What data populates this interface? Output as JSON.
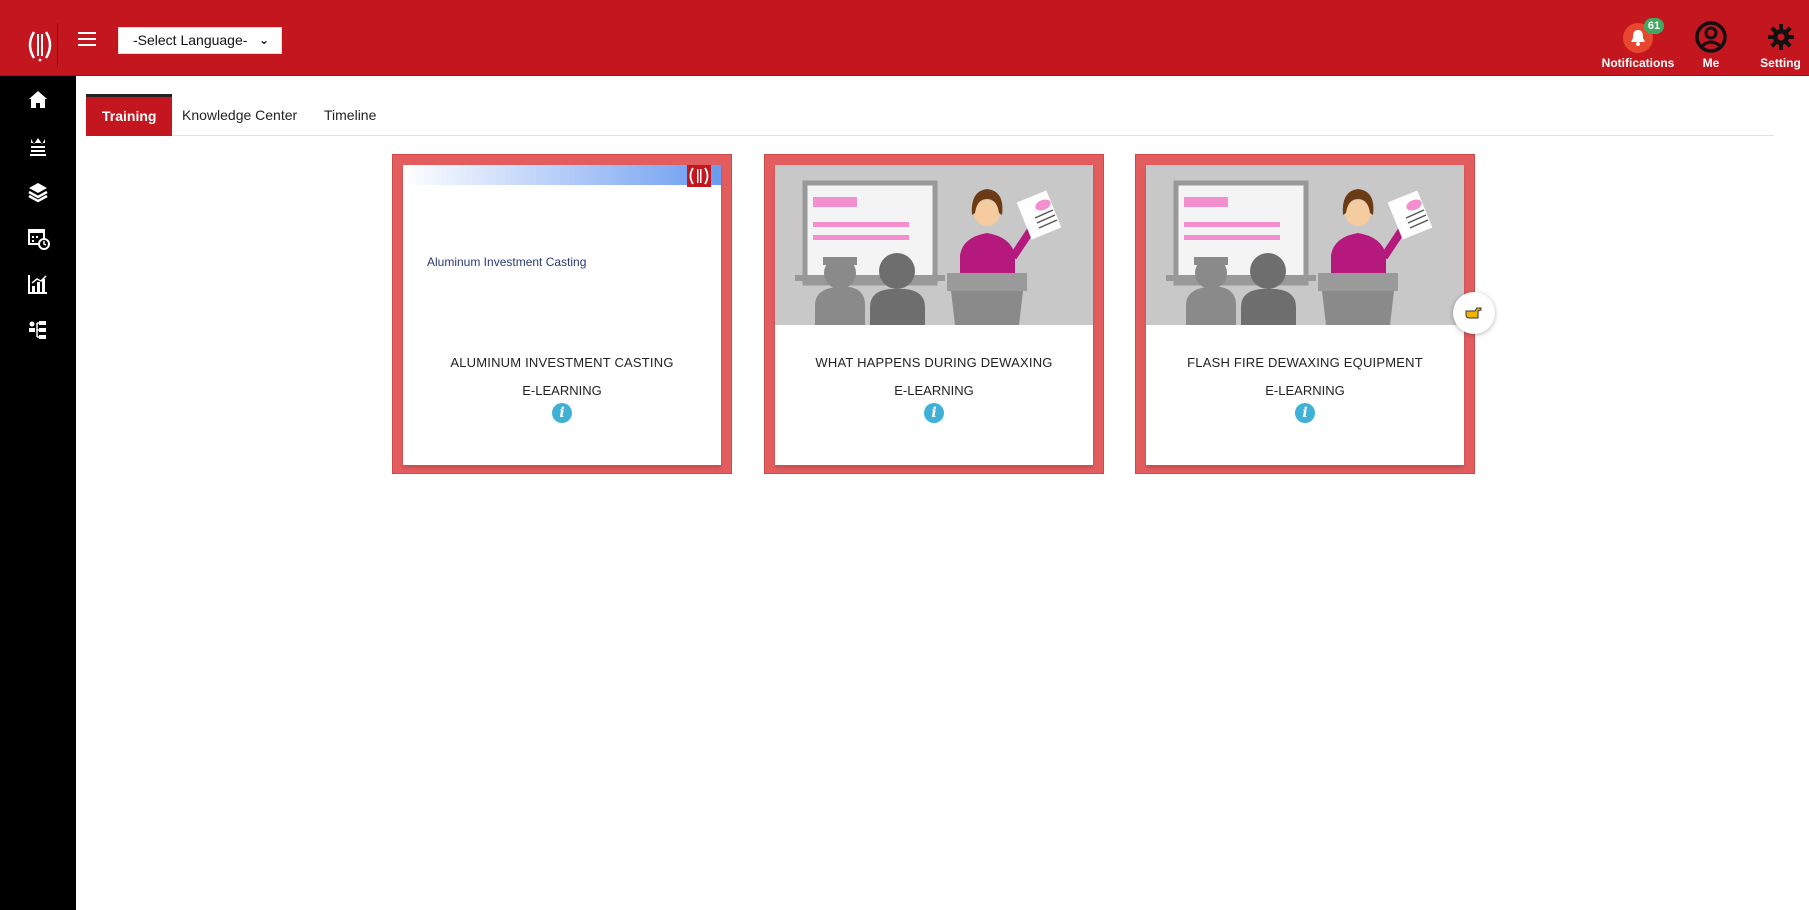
{
  "header": {
    "language_select": "-Select Language-",
    "notifications_label": "Notifications",
    "notifications_count": "61",
    "me_label": "Me",
    "setting_label": "Setting",
    "brand_color": "#c4161e"
  },
  "sidebar": {
    "items": [
      {
        "icon": "home-icon"
      },
      {
        "icon": "trophy-icon"
      },
      {
        "icon": "layers-icon"
      },
      {
        "icon": "calendar-clock-icon"
      },
      {
        "icon": "chart-icon"
      },
      {
        "icon": "org-chart-icon"
      }
    ]
  },
  "tabs": [
    {
      "label": "Training",
      "active": true
    },
    {
      "label": "Knowledge Center",
      "active": false
    },
    {
      "label": "Timeline",
      "active": false
    }
  ],
  "cards": [
    {
      "image_text": "Aluminum Investment Casting",
      "title": "ALUMINUM INVESTMENT CASTING",
      "type": "E-LEARNING",
      "info": "i"
    },
    {
      "title": "WHAT HAPPENS DURING DEWAXING",
      "type": "E-LEARNING",
      "info": "i"
    },
    {
      "title": "FLASH FIRE DEWAXING EQUIPMENT",
      "type": "E-LEARNING",
      "info": "i"
    }
  ]
}
